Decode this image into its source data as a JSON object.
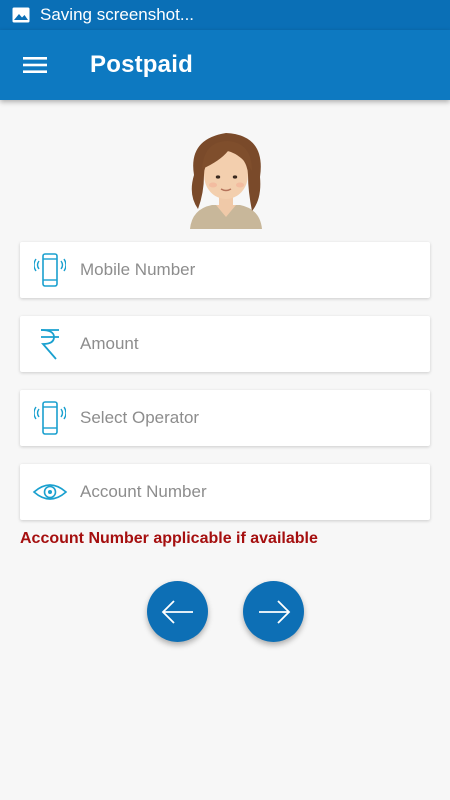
{
  "status_bar": {
    "text": "Saving screenshot...",
    "icon": "image-icon"
  },
  "app_bar": {
    "title": "Postpaid",
    "menu_icon": "hamburger-menu-icon"
  },
  "avatar": {
    "icon": "user-avatar"
  },
  "form": {
    "fields": [
      {
        "icon": "mobile-phone-icon",
        "placeholder": "Mobile Number",
        "value": ""
      },
      {
        "icon": "rupee-icon",
        "placeholder": "Amount",
        "value": ""
      },
      {
        "icon": "mobile-phone-icon",
        "placeholder": "Select Operator",
        "value": ""
      },
      {
        "icon": "eye-icon",
        "placeholder": "Account Number",
        "value": ""
      }
    ],
    "note": "Account Number applicable if available"
  },
  "navigation": {
    "back_icon": "arrow-left-icon",
    "next_icon": "arrow-right-icon"
  },
  "colors": {
    "primary": "#0d79c1",
    "status_bar": "#0a6fb6",
    "icon_accent": "#1aa0cf",
    "note_red": "#a50f0f",
    "background": "#f7f7f7"
  }
}
